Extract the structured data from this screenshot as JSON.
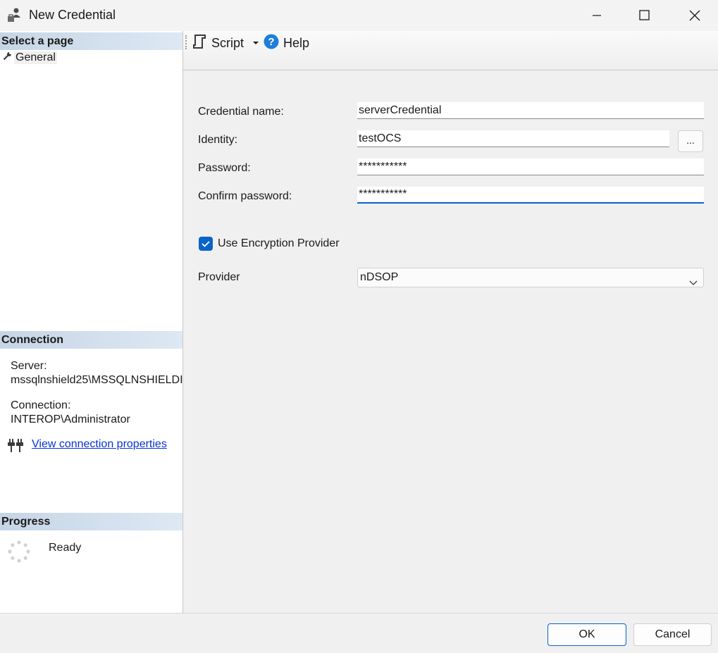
{
  "window": {
    "title": "New Credential"
  },
  "left_pane": {
    "select_page_header": "Select a page",
    "pages": [
      {
        "label": "General"
      }
    ],
    "connection_header": "Connection",
    "server_label": "Server:",
    "server_value": "mssqlnshield25\\MSSQLNSHIELDI",
    "connection_label": "Connection:",
    "connection_value": "INTEROP\\Administrator",
    "view_connection_properties": "View connection properties",
    "progress_header": "Progress",
    "progress_status": "Ready"
  },
  "toolbar": {
    "script_label": "Script",
    "help_label": "Help"
  },
  "form": {
    "credential_name_label": "Credential name:",
    "credential_name_value": "serverCredential",
    "identity_label": "Identity:",
    "identity_value": "testOCS",
    "browse_label": "...",
    "password_label": "Password:",
    "password_value": "***********",
    "confirm_password_label": "Confirm password:",
    "confirm_password_value": "***********",
    "use_encryption_provider_label": "Use Encryption Provider",
    "use_encryption_provider_checked": true,
    "provider_label": "Provider",
    "provider_value": "nDSOP"
  },
  "footer": {
    "ok_label": "OK",
    "cancel_label": "Cancel"
  },
  "colors": {
    "accent": "#0a63c8",
    "link": "#0a33cc",
    "section_header": "#c6d5e6"
  }
}
